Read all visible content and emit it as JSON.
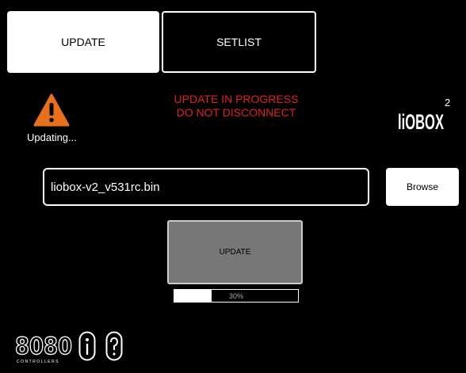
{
  "tabs": {
    "update": "UPDATE",
    "setlist": "SETLIST"
  },
  "status": {
    "text": "Updating...",
    "icon": "warning-icon",
    "icon_color": "#E8701A"
  },
  "alert": {
    "line1": "UPDATE IN PROGRESS",
    "line2": "DO NOT DISCONNECT",
    "color": "#E0201F"
  },
  "logo": {
    "text": "liOBOX",
    "superscript": "2"
  },
  "file": {
    "value": "liobox-v2_v531rc.bin"
  },
  "buttons": {
    "browse": "Browse",
    "update": "UPDATE",
    "info_icon": "info-icon",
    "help_icon": "help-icon"
  },
  "progress": {
    "percent": 30,
    "label": "30%"
  },
  "brand": {
    "main": "8080",
    "sub": "CONTROLLERS"
  }
}
